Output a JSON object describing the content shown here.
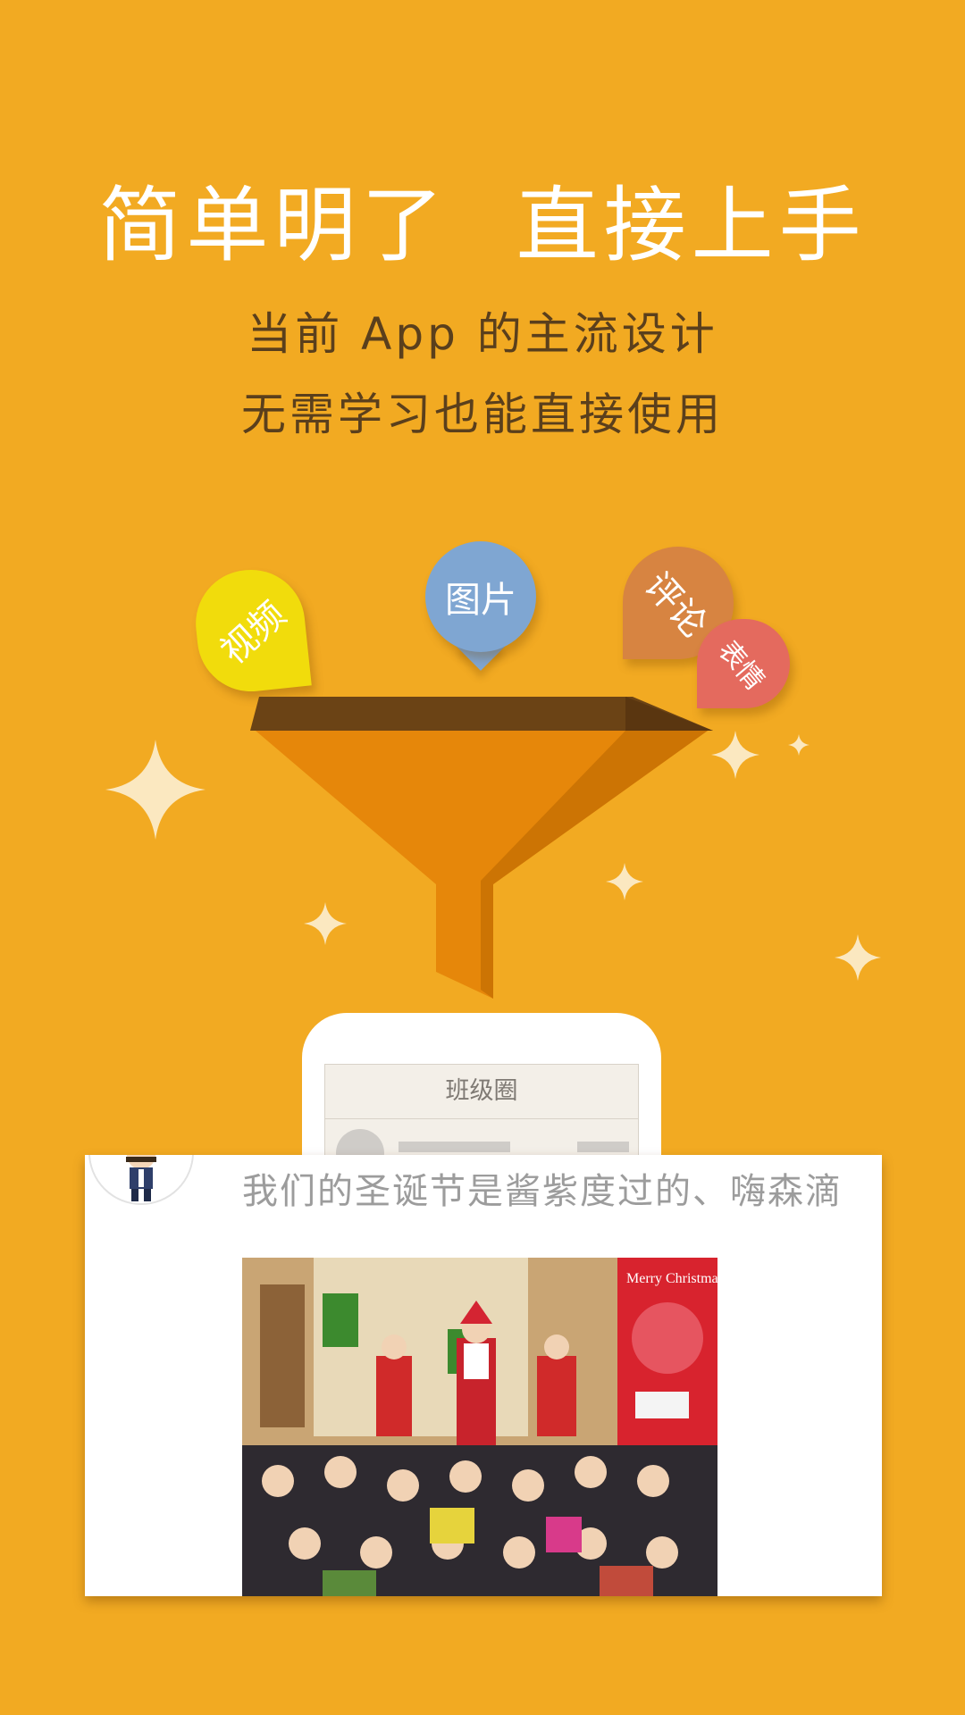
{
  "headline": "简单明了  直接上手",
  "subtitle_lines": [
    "当前 App 的主流设计",
    "无需学习也能直接使用"
  ],
  "bubbles": {
    "video": "视频",
    "image": "图片",
    "comment": "评论",
    "emoji": "表情"
  },
  "phone": {
    "header_title": "班级圈"
  },
  "post": {
    "text": "我们的圣诞节是酱紫度过的、嗨森滴",
    "photo_label": "Merry Christmas"
  },
  "colors": {
    "background": "#F2AA22",
    "headline": "#FFFFFF",
    "subtitle": "#5A3F1C",
    "funnel_rim": "#6B4315",
    "funnel_body": "#E6870A",
    "funnel_shade": "#CC7404",
    "sparkle": "#FBE8C0",
    "bubble_video": "#F1DC0C",
    "bubble_image": "#7FA6D2",
    "bubble_comment": "#D78441",
    "bubble_emoji": "#E46A5E"
  },
  "icons": [
    "sparkle-icon",
    "funnel-icon",
    "avatar-icon"
  ]
}
